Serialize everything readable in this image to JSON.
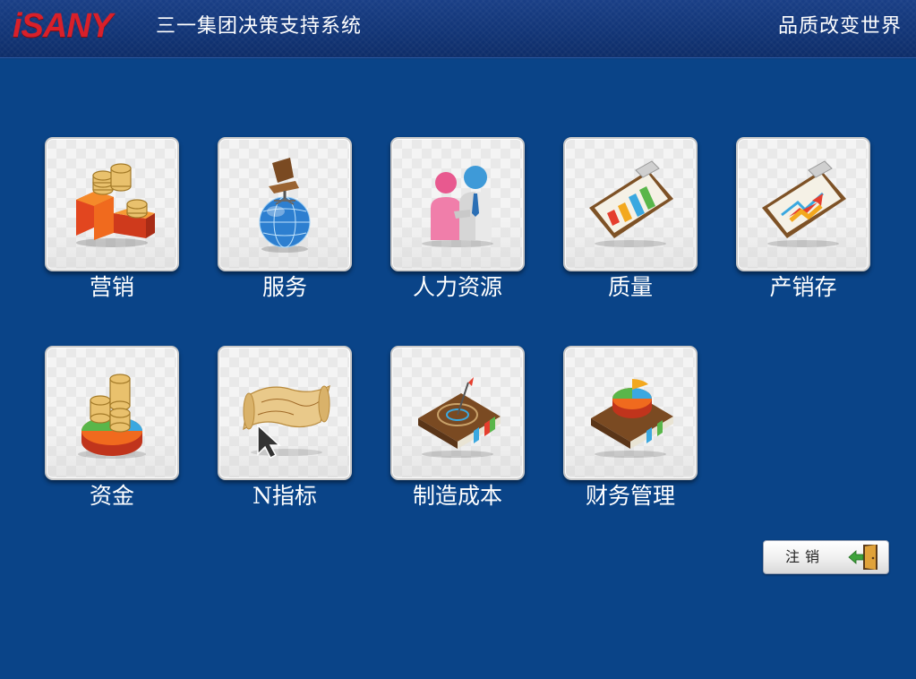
{
  "header": {
    "logo_text": "iSANY",
    "system_title": "三一集团决策支持系统",
    "slogan": "品质改变世界"
  },
  "modules": [
    {
      "label": "营销",
      "icon": "podium-coins-icon"
    },
    {
      "label": "服务",
      "icon": "globe-chair-icon"
    },
    {
      "label": "人力资源",
      "icon": "people-icon"
    },
    {
      "label": "质量",
      "icon": "clipboard-bar-chart-icon"
    },
    {
      "label": "产销存",
      "icon": "clipboard-trend-icon"
    },
    {
      "label": "资金",
      "icon": "coins-pie-chart-icon"
    },
    {
      "label": "N指标",
      "icon": "map-cursor-icon"
    },
    {
      "label": "制造成本",
      "icon": "book-target-icon"
    },
    {
      "label": "财务管理",
      "icon": "book-pie-chart-icon"
    }
  ],
  "logout": {
    "label": "注销",
    "icon": "exit-door-icon"
  },
  "colors": {
    "background": "#0a4488",
    "header": "#123577",
    "logo": "#d8202a"
  }
}
